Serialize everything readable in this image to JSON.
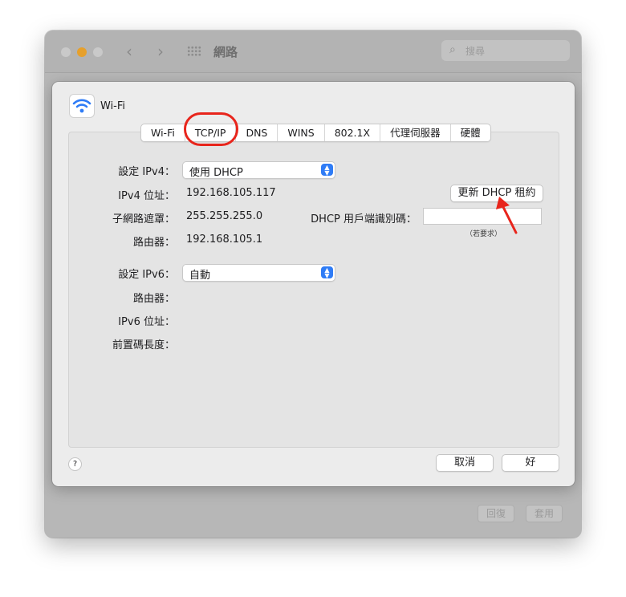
{
  "window": {
    "title": "網路"
  },
  "search": {
    "placeholder": "搜尋"
  },
  "background_buttons": {
    "revert": "回復",
    "apply": "套用"
  },
  "sheet": {
    "interface": "Wi-Fi",
    "tabs": [
      "Wi-Fi",
      "TCP/IP",
      "DNS",
      "WINS",
      "802.1X",
      "代理伺服器",
      "硬體"
    ],
    "selected_tab": "TCP/IP",
    "ipv4": {
      "configure_label": "設定 IPv4：",
      "configure_value": "使用 DHCP",
      "address_label": "IPv4 位址：",
      "address_value": "192.168.105.117",
      "subnet_label": "子網路遮罩：",
      "subnet_value": "255.255.255.0",
      "router_label": "路由器：",
      "router_value": "192.168.105.1",
      "renew_button": "更新 DHCP 租約",
      "client_id_label": "DHCP 用戶端識別碼：",
      "client_id_value": "",
      "client_id_hint": "（若要求）"
    },
    "ipv6": {
      "configure_label": "設定 IPv6：",
      "configure_value": "自動",
      "router_label": "路由器：",
      "address_label": "IPv6 位址：",
      "prefix_label": "前置碼長度："
    },
    "help_label": "?",
    "cancel_button": "取消",
    "ok_button": "好"
  },
  "colors": {
    "accent": "#2f7cf6",
    "annotation": "#e8251c",
    "minimize_light": "#e6a02c"
  }
}
